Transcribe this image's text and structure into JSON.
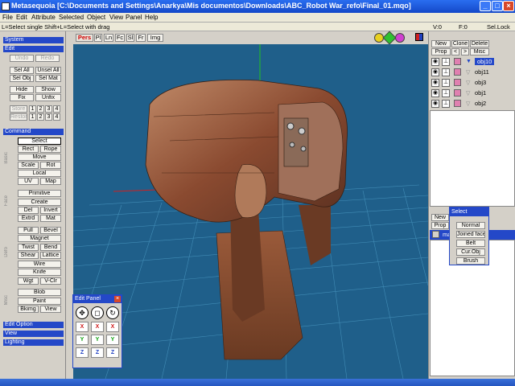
{
  "window": {
    "title": "Metasequoia [C:\\Documents and Settings\\Anarkya\\Mis documentos\\Downloads\\ABC_Robot War_refo\\Final_01.mqo]",
    "min": "_",
    "max": "□",
    "close": "×"
  },
  "menu": [
    "File",
    "Edit",
    "Attribute",
    "Selected",
    "Object",
    "View",
    "Panel",
    "Help"
  ],
  "hint": "L=Select single  Shift+L=Select with drag",
  "coords": {
    "v": "V:0",
    "f": "F:0",
    "sel_lock": "Sel.Lock"
  },
  "left": {
    "system": "System",
    "edit": "Edit",
    "undo": "Undo",
    "redo": "Redo",
    "sel_all": "Sel All",
    "unsel_all": "Unsel All",
    "sel_obj": "Sel Obj",
    "sel_mat": "Sel Mat",
    "hide": "Hide",
    "show": "Show",
    "fix": "Fix",
    "unfix": "Unfix",
    "store": "Store",
    "restore": "Restore",
    "nums": [
      "1",
      "2",
      "3",
      "4"
    ],
    "command": "Command",
    "cmd_select": "Select",
    "rect": "Rect",
    "rope": "Rope",
    "move": "Move",
    "scale": "Scale",
    "rot": "Rot",
    "local": "Local",
    "uv": "UV",
    "map": "Map",
    "primitive": "Primitive",
    "create": "Create",
    "del": "Del",
    "invert": "Invert",
    "extrd": "Extrd",
    "mat": "Mat",
    "pull": "Pull",
    "bevel": "Bevel",
    "magnet": "Magnet",
    "twist": "Twist",
    "bend": "Bend",
    "shear": "Shear",
    "lattice": "Lattice",
    "wire": "Wire",
    "knife": "Knife",
    "wgt": "Wgt",
    "vclr": "V-Clr",
    "blob": "Blob",
    "paint": "Paint",
    "bkimg": "Bkimg",
    "view": "View",
    "edit_option": "Edit Option",
    "view_hdr": "View",
    "lighting": "Lighting",
    "side_labels": {
      "basic": "Basic",
      "face": "Face",
      "defo": "Defo",
      "misc": "Misc"
    }
  },
  "viewtabs": [
    "Pers",
    "Pl",
    "Ln",
    "Fc",
    "Sl",
    "Fr",
    "Img"
  ],
  "right": {
    "new": "New",
    "clone": "Clone",
    "delete": "Delete",
    "prop": "Prop",
    "left_arrow": "<",
    "right_arrow": ">",
    "misc": "Misc",
    "objects": [
      {
        "name": "obj10",
        "active": true
      },
      {
        "name": "obj11",
        "active": false
      },
      {
        "name": "obj3",
        "active": false
      },
      {
        "name": "obj1",
        "active": false
      },
      {
        "name": "obj2",
        "active": false
      }
    ],
    "mat_new": "New",
    "mat_prop": "Prop",
    "mat_name": "ma"
  },
  "editpanel": {
    "title": "Edit Panel",
    "x": "X",
    "y": "Y",
    "z": "Z"
  },
  "selectpanel": {
    "title": "Select",
    "items": [
      "Normal",
      "Joined face",
      "Belt",
      "Cur.Obj",
      "Brush"
    ]
  },
  "colors": {
    "accent": "#2448c8",
    "viewport_bg": "#1f5f8a",
    "material": "#e080b0"
  }
}
